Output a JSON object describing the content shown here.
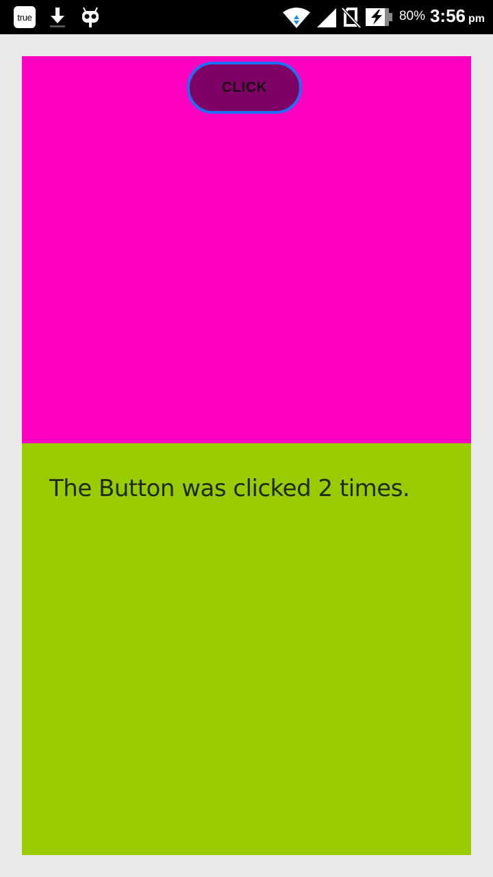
{
  "status_bar": {
    "true_label": "true",
    "battery_percent": "80%",
    "time": "3:56",
    "ampm": "pm",
    "icons": [
      "true-icon",
      "download-icon",
      "cyanogen-icon",
      "wifi-icon",
      "signal-icon",
      "no-sim-icon",
      "battery-charging-icon"
    ]
  },
  "main": {
    "button_label": "CLICK",
    "result_text": "The Button was clicked 2 times."
  },
  "colors": {
    "background": "#e9e9e9",
    "top_panel": "#ff00c3",
    "bottom_panel": "#99cc00",
    "button_fill": "#7f0064",
    "button_border": "#1e6ff5"
  }
}
